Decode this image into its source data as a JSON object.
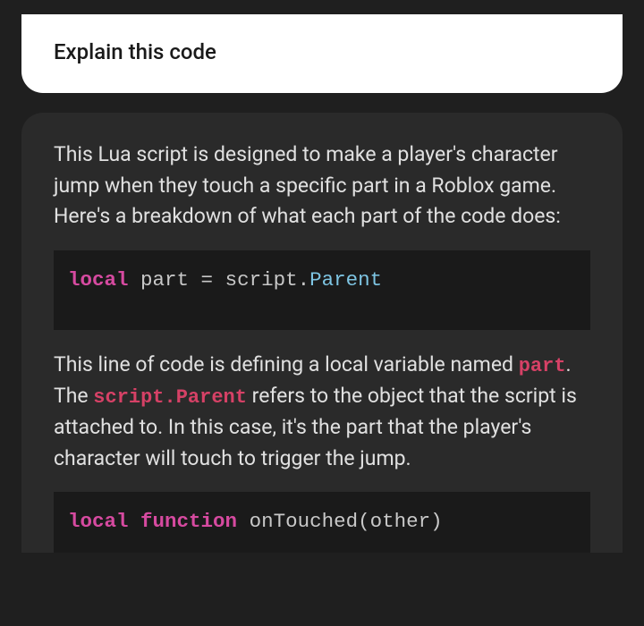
{
  "user_message": {
    "text": "Explain this code"
  },
  "assistant": {
    "intro": "This Lua script is designed to make a player's character jump when they touch a specific part in a Roblox game. Here's a breakdown of what each part of the code does:",
    "code1": {
      "tokens": [
        {
          "t": "local",
          "c": "keyword"
        },
        {
          "t": " ",
          "c": "punct"
        },
        {
          "t": "part",
          "c": "ident"
        },
        {
          "t": " = ",
          "c": "punct"
        },
        {
          "t": "script",
          "c": "ident"
        },
        {
          "t": ".",
          "c": "punct"
        },
        {
          "t": "Parent",
          "c": "prop"
        }
      ]
    },
    "para2_parts": {
      "p1": "This line of code is defining a local variable named ",
      "c1": "part",
      "p2": ". The ",
      "c2": "script.Parent",
      "p3": " refers to the object that the script is attached to. In this case, it's the part that the player's character will touch to trigger the jump."
    },
    "code2": {
      "tokens": [
        {
          "t": "local",
          "c": "keyword"
        },
        {
          "t": " ",
          "c": "punct"
        },
        {
          "t": "function",
          "c": "keyword"
        },
        {
          "t": " ",
          "c": "punct"
        },
        {
          "t": "onTouched",
          "c": "func"
        },
        {
          "t": "(",
          "c": "punct"
        },
        {
          "t": "other",
          "c": "ident"
        },
        {
          "t": ")",
          "c": "punct"
        }
      ]
    }
  }
}
